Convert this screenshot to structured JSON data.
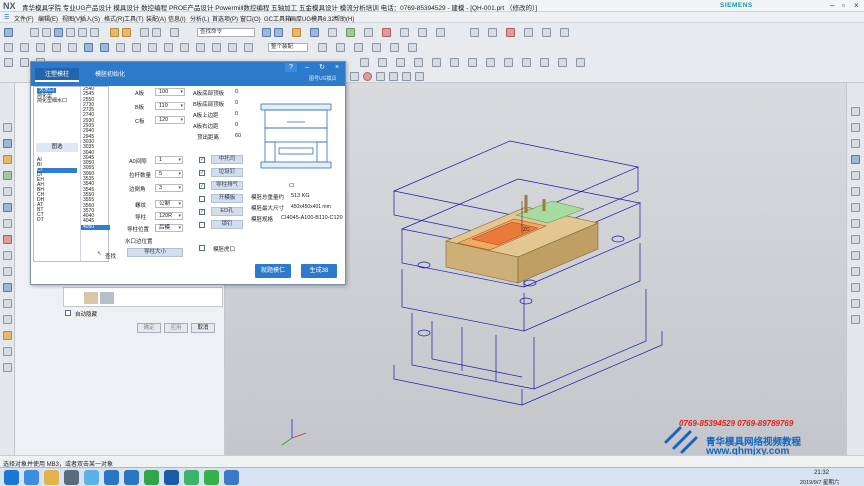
{
  "window": {
    "logo": "NX",
    "title": "青华模具学院 专业UG产品设计 模具设计 数控编程 PROE产品设计 Powermill数控编程 五轴加工 五金模具设计 模流分析培训 电话：0769-85394529 - 建模 - [QH-001.prt （修改的）]",
    "brand": "SIEMENS"
  },
  "menu": [
    "文件(F)",
    "编辑(E)",
    "视图(V)",
    "插入(S)",
    "格式(R)",
    "工具(T)",
    "装配(A)",
    "信息(I)",
    "分析(L)",
    "首选项(P)",
    "窗口(O)",
    "GC工具箱",
    "画厚UG模具6.32",
    "帮助(H)"
  ],
  "ribbon": {
    "search_placeholder": "查找命令",
    "dropdown": "整个装配"
  },
  "dialog": {
    "tabs": [
      "注塑模柱",
      "模胚初始化"
    ],
    "right_caption": "图号UG模具",
    "left_header": "大水口",
    "list_types": [
      "大水口",
      "简化型",
      "简化型细水口"
    ],
    "letters": [
      "AI",
      "BI",
      "CI",
      "DI",
      "EH",
      "AH",
      "BH",
      "CH",
      "DH",
      "AT",
      "BT",
      "CT",
      "DT"
    ],
    "tab_label": "图选",
    "numbers": [
      "2540",
      "2545",
      "2550",
      "2730",
      "2735",
      "2740",
      "2930",
      "2935",
      "2940",
      "2945",
      "3030",
      "3035",
      "3040",
      "3045",
      "3050",
      "3055",
      "3060",
      "3535",
      "3540",
      "3545",
      "3550",
      "3555",
      "3560",
      "3570",
      "4040",
      "4045",
      "4050"
    ],
    "search_label": "查找",
    "plates": [
      {
        "label": "A板",
        "value": "100"
      },
      {
        "label": "B板",
        "value": "110"
      },
      {
        "label": "C板",
        "value": "120"
      }
    ],
    "options": [
      {
        "label": "A板底部顶板",
        "value": "0"
      },
      {
        "label": "B板底部顶板",
        "value": "0"
      },
      {
        "label": "A板上边距",
        "value": "0"
      },
      {
        "label": "A板右边距",
        "value": "0"
      },
      {
        "label": "顶出距离",
        "value": "60"
      }
    ],
    "params": [
      {
        "label": "A0间隙",
        "value": "1"
      },
      {
        "label": "拉杆数量",
        "value": "5"
      },
      {
        "label": "边倒角",
        "value": "3"
      },
      {
        "label": "螺纹",
        "value": "公制"
      },
      {
        "label": "导柱",
        "value": "120R"
      },
      {
        "label": "导柱位置",
        "value": "后模"
      }
    ],
    "water_label": "水口边位置",
    "guide_size_btn": "导柱大小",
    "checks": [
      {
        "label": "中托司",
        "checked": true
      },
      {
        "label": "垃圾钉",
        "checked": true
      },
      {
        "label": "导柱排气",
        "checked": true
      },
      {
        "label": "开模板",
        "checked": false
      },
      {
        "label": "ED孔",
        "checked": true
      },
      {
        "label": "锁钉",
        "checked": false
      }
    ],
    "mold_code": "CI",
    "weight_label": "模胚总重量约",
    "weight_value": "513 KG",
    "size_label": "模胚最大尺寸",
    "size_value": "450x450x401 mm",
    "spec_label": "模胚规格",
    "spec_value": "CI4045-A100-B110-C120",
    "open_chk": "模胚虎口",
    "btn_edit": "就题模仁",
    "btn_generate": "生成38"
  },
  "under_panel": {
    "auto_hide": "自动隐藏",
    "btn_ok": "确定",
    "btn_apply": "应用",
    "btn_cancel": "取消"
  },
  "graphics": {
    "axis_label": "ZC"
  },
  "watermark": {
    "phones": "0769-85394529  0769-89789769",
    "org": "青华模具网络视频教程",
    "url": "www.qhmjxy.com"
  },
  "status": "选择对象并使用 MB3，或者双击某一对象",
  "clock": {
    "time": "21:32",
    "date": "2019/9/7 星期六"
  }
}
